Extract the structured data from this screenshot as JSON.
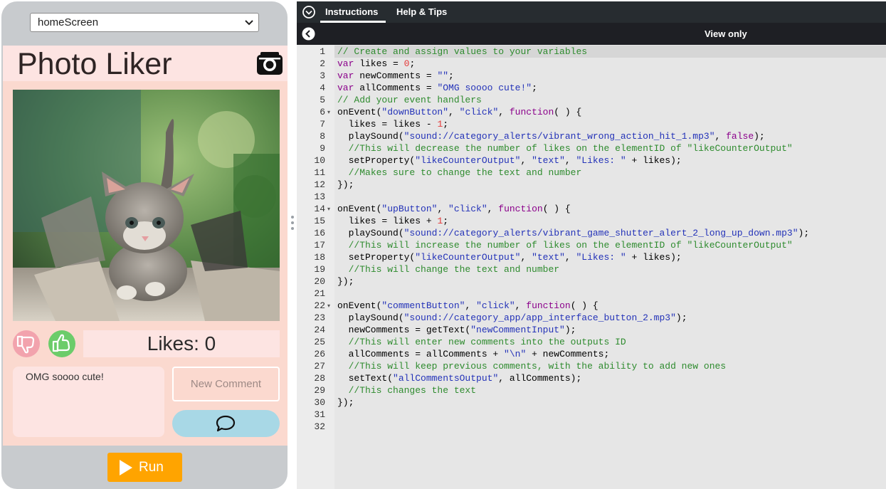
{
  "app_preview": {
    "screen_selector": "homeScreen",
    "title": "Photo Liker",
    "likes_text": "Likes: 0",
    "comments_text": "OMG soooo cute!",
    "comment_placeholder": "New Comment",
    "run_label": "Run"
  },
  "panel": {
    "tabs": [
      "Instructions",
      "Help & Tips"
    ],
    "view_mode": "View only"
  },
  "code_lines": [
    "// Create and assign values to your variables",
    "var likes = 0;",
    "var newComments = \"\";",
    "var allComments = \"OMG soooo cute!\";",
    "// Add your event handlers",
    "onEvent(\"downButton\", \"click\", function( ) {",
    "  likes = likes - 1;",
    "  playSound(\"sound://category_alerts/vibrant_wrong_action_hit_1.mp3\", false);",
    "  //This will decrease the number of likes on the elementID of \"likeCounterOutput\"",
    "  setProperty(\"likeCounterOutput\", \"text\", \"Likes: \" + likes);",
    "  //Makes sure to change the text and number",
    "});",
    "",
    "onEvent(\"upButton\", \"click\", function( ) {",
    "  likes = likes + 1;",
    "  playSound(\"sound://category_alerts/vibrant_game_shutter_alert_2_long_up_down.mp3\");",
    "  //This will increase the number of likes on the elementID of \"likeCounterOutput\"",
    "  setProperty(\"likeCounterOutput\", \"text\", \"Likes: \" + likes);",
    "  //This will change the text and number",
    "});",
    "",
    "onEvent(\"commentButton\", \"click\", function( ) {",
    "  playSound(\"sound://category_app/app_interface_button_2.mp3\");",
    "  newComments = getText(\"newCommentInput\");",
    "  //This will enter new comments into the outputs ID",
    "  allComments = allComments + \"\\n\" + newComments;",
    "  //This will keep previous comments, with the ability to add new ones",
    "  setText(\"allCommentsOutput\", allComments);",
    "  //This changes the text",
    "});",
    "",
    ""
  ],
  "colors": {
    "app_background": "#fbd9cf",
    "header_background": "#fde4e2",
    "comment_button": "#a8d8e6",
    "run_button": "#ffa400",
    "down_button": "#f2a3ad",
    "up_button": "#6ccc6a"
  }
}
